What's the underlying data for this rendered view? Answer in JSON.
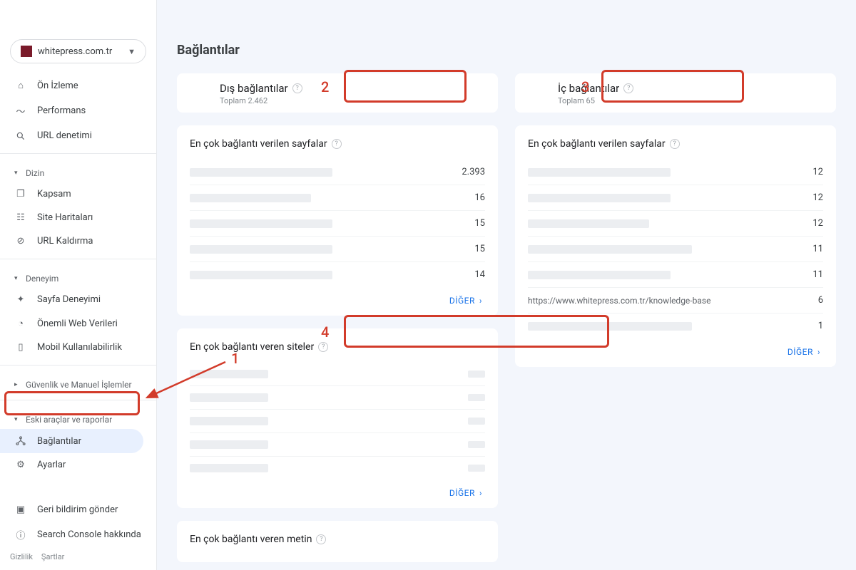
{
  "property": {
    "domain": "whitepress.com.tr"
  },
  "sidebar": {
    "items": {
      "overview": "Ön İzleme",
      "performance": "Performans",
      "url_inspect": "URL denetimi",
      "index_group": "Dizin",
      "coverage": "Kapsam",
      "sitemaps": "Site Haritaları",
      "removals": "URL Kaldırma",
      "experience_group": "Deneyim",
      "page_exp": "Sayfa Deneyimi",
      "cwv": "Önemli Web Verileri",
      "mobile": "Mobil Kullanılabilirlik",
      "security_group": "Güvenlik ve Manuel İşlemler",
      "legacy_group": "Eski araçlar ve raporlar",
      "links": "Bağlantılar",
      "settings": "Ayarlar",
      "feedback": "Geri bildirim gönder",
      "about": "Search Console hakkında"
    },
    "legal_privacy": "Gizlilik",
    "legal_terms": "Şartlar"
  },
  "page": {
    "title": "Bağlantılar"
  },
  "external": {
    "title": "Dış bağlantılar",
    "total_label": "Toplam 2.462",
    "top_pages_title": "En çok bağlantı verilen sayfalar",
    "rows": [
      {
        "value": "2.393"
      },
      {
        "value": "16"
      },
      {
        "value": "15"
      },
      {
        "value": "15"
      },
      {
        "value": "14"
      }
    ],
    "top_sites_title": "En çok bağlantı veren siteler",
    "top_text_title": "En çok bağlantı veren metin"
  },
  "internal": {
    "title": "İç bağlantılar",
    "total_label": "Toplam 65",
    "top_pages_title": "En çok bağlantı verilen sayfalar",
    "rows": [
      {
        "value": "12"
      },
      {
        "value": "12"
      },
      {
        "value": "12"
      },
      {
        "value": "11"
      },
      {
        "value": "11"
      },
      {
        "text": "https://www.whitepress.com.tr/knowledge-base",
        "value": "6"
      },
      {
        "value": "1"
      }
    ]
  },
  "more_label": "DİĞER",
  "annotations": {
    "n1": "1",
    "n2": "2",
    "n3": "3",
    "n4": "4"
  }
}
